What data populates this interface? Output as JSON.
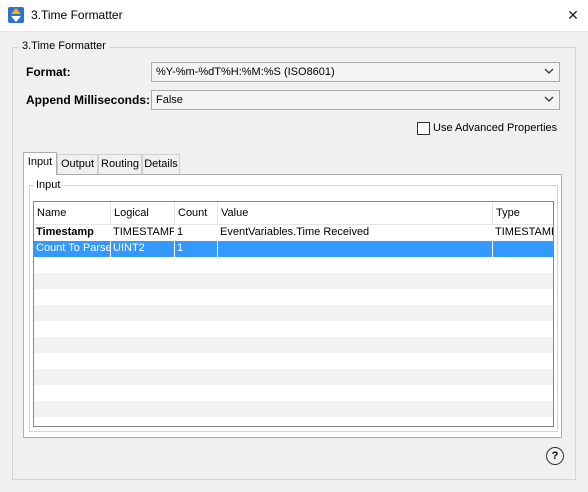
{
  "window": {
    "title": "3.Time Formatter",
    "close_glyph": "✕"
  },
  "group": {
    "label": "3.Time Formatter"
  },
  "format": {
    "label": "Format:",
    "value": "%Y-%m-%dT%H:%M:%S (ISO8601)"
  },
  "milliseconds": {
    "label": "Append Milliseconds:",
    "value": "False"
  },
  "advanced": {
    "label": "Use Advanced Properties",
    "checked": false
  },
  "tabs": [
    {
      "label": "Input",
      "active": true
    },
    {
      "label": "Output",
      "active": false
    },
    {
      "label": "Routing",
      "active": false
    },
    {
      "label": "Details",
      "active": false
    }
  ],
  "input_group": {
    "label": "Input"
  },
  "table": {
    "columns": [
      "Name",
      "Logical",
      "Count",
      "Value",
      "Type"
    ],
    "rows": [
      {
        "name": "Timestamp",
        "logical": "TIMESTAMP",
        "count": "1",
        "value": "EventVariables.Time Received",
        "type": "TIMESTAMP"
      },
      {
        "name": "Count To Parse",
        "logical": "UINT2",
        "count": "1",
        "value": "",
        "type": ""
      }
    ]
  },
  "help": {
    "glyph": "?"
  },
  "icons": {
    "app": "up-down-arrows-icon",
    "dropdown": "chevron-down-icon",
    "help": "help-icon",
    "close": "close-icon"
  },
  "colors": {
    "selection": "#3399ff",
    "app_icon": "#2f6fd6"
  }
}
